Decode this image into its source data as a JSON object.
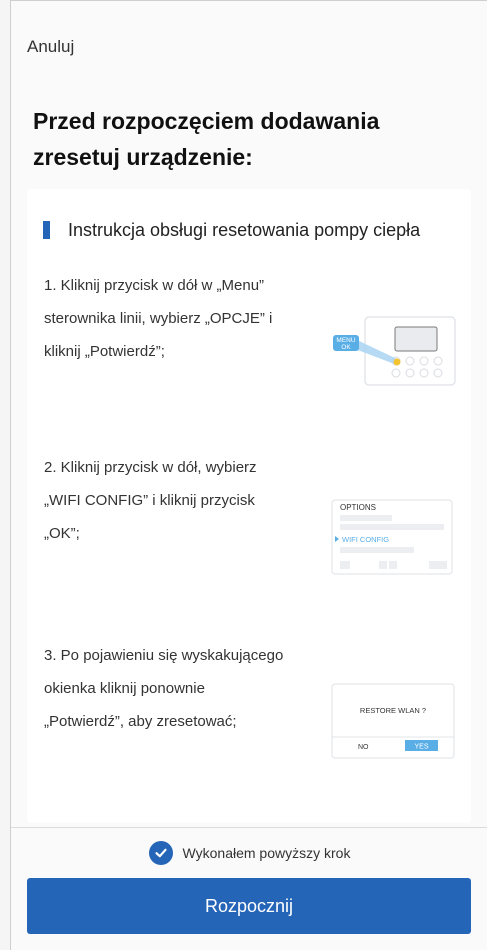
{
  "cancel_label": "Anuluj",
  "title": "Przed rozpoczęciem dodawania zresetuj urządzenie:",
  "instructions": {
    "heading": "Instrukcja obsługi resetowania pompy ciepła",
    "steps": [
      {
        "lines": [
          "1. Kliknij przycisk w dół w „Menu”",
          "sterownika linii, wybierz „OPCJE” i",
          "kliknij „Potwierdź”;"
        ],
        "illustration": {
          "label_top": "MENU",
          "label_bottom": "OK"
        }
      },
      {
        "lines": [
          "2. Kliknij przycisk w dół, wybierz",
          "„WIFI CONFIG” i kliknij przycisk",
          "„OK”;"
        ],
        "illustration": {
          "title": "OPTIONS",
          "selected_item": "WIFI CONFIG"
        }
      },
      {
        "lines": [
          "3. Po pojawieniu się wyskakującego",
          "okienka kliknij ponownie",
          "„Potwierdź”, aby zresetować;"
        ],
        "illustration": {
          "message": "RESTORE WLAN ?",
          "no_label": "NO",
          "yes_label": "YES"
        }
      }
    ]
  },
  "confirm_label": "Wykonałem powyższy krok",
  "start_button_label": "Rozpocznij",
  "colors": {
    "accent": "#2465b8",
    "illustration_blue": "#5aaee6",
    "indicator_yellow": "#f4c430"
  },
  "icons": {
    "check": "check-circle-icon"
  }
}
